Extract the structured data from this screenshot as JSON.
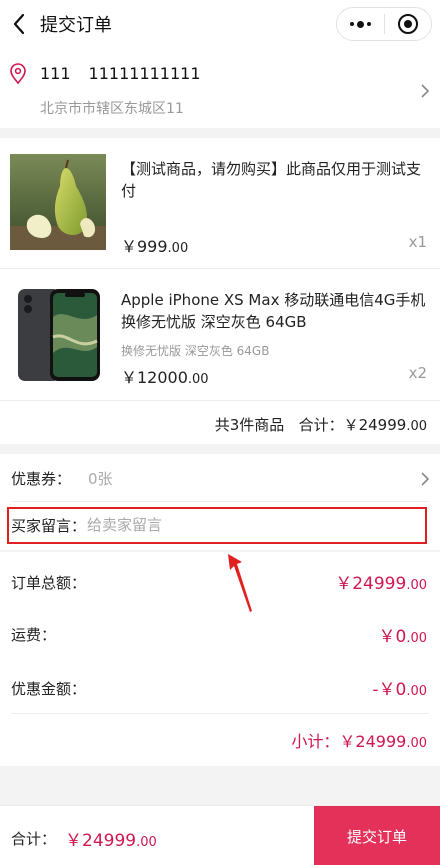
{
  "navbar": {
    "title": "提交订单",
    "back_icon": "chevron-left-icon",
    "more_icon": "more-dots-icon",
    "close_icon": "capsule-close-icon"
  },
  "address": {
    "name": "111",
    "phone": "11111111111",
    "detail": "北京市市辖区东城区11",
    "pin_icon": "location-pin-icon"
  },
  "goods": [
    {
      "title": "【测试商品，请勿购买】此商品仅用于测试支付",
      "spec": "",
      "price_int": "￥999",
      "price_dec": ".00",
      "qty": "x1",
      "image_icon": "pear-product-image"
    },
    {
      "title": "Apple iPhone XS Max 移动联通电信4G手机 换修无忧版 深空灰色 64GB",
      "spec": "换修无忧版 深空灰色 64GB",
      "price_int": "￥12000",
      "price_dec": ".00",
      "qty": "x2",
      "image_icon": "iphone-product-image"
    }
  ],
  "goods_summary": {
    "count_text": "共3件商品",
    "total_label": "合计：",
    "total_int": "￥24999",
    "total_dec": ".00"
  },
  "coupon": {
    "label": "优惠券：",
    "value": "0张"
  },
  "message": {
    "label": "买家留言：",
    "placeholder": "给卖家留言",
    "value": ""
  },
  "summary": {
    "order_total_label": "订单总额：",
    "order_total_int": "￥24999",
    "order_total_dec": ".00",
    "shipping_label": "运费：",
    "shipping_int": "￥0",
    "shipping_dec": ".00",
    "discount_label": "优惠金额：",
    "discount_int": "-￥0",
    "discount_dec": ".00",
    "subtotal_label": "小计：",
    "subtotal_int": "￥24999",
    "subtotal_dec": ".00"
  },
  "bottom": {
    "total_label": "合计：",
    "total_int": "￥24999",
    "total_dec": ".00",
    "submit_label": "提交订单"
  },
  "colors": {
    "accent": "#d0174f",
    "submit_bg": "#e4315a",
    "highlight_box": "#e0201e"
  }
}
